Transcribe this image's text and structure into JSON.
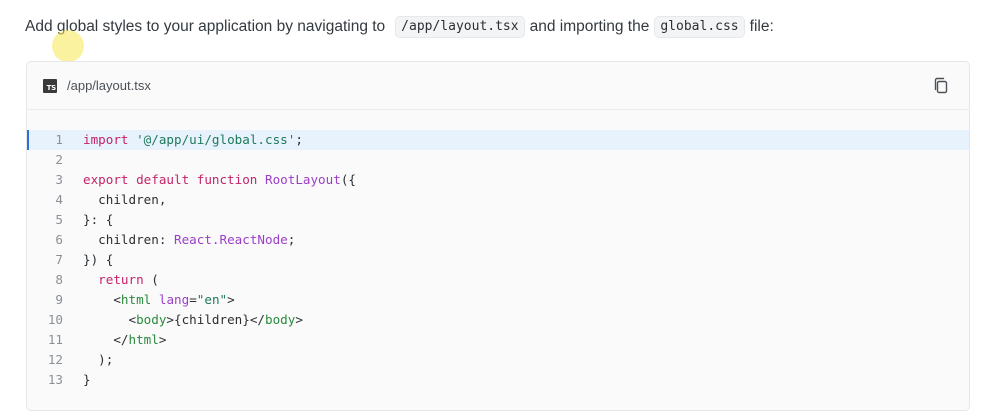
{
  "intro": {
    "text_before": "Add global styles to your application by navigating to",
    "path_code": "/app/layout.tsx",
    "text_middle": "and importing the",
    "file_code": "global.css",
    "text_after": "file:"
  },
  "code_block": {
    "file_icon": "TS",
    "file_path": "/app/layout.tsx",
    "copy_icon": "copy-icon",
    "highlighted_line": 1,
    "lines": [
      {
        "n": "1",
        "tokens": [
          [
            "kw",
            "import"
          ],
          [
            "pl",
            " "
          ],
          [
            "str",
            "'@/app/ui/global.css'"
          ],
          [
            "pl",
            ";"
          ]
        ]
      },
      {
        "n": "2",
        "tokens": []
      },
      {
        "n": "3",
        "tokens": [
          [
            "kw",
            "export default function"
          ],
          [
            "pl",
            " "
          ],
          [
            "fn",
            "RootLayout"
          ],
          [
            "pl",
            "({"
          ]
        ]
      },
      {
        "n": "4",
        "tokens": [
          [
            "pl",
            "  children,"
          ]
        ]
      },
      {
        "n": "5",
        "tokens": [
          [
            "pl",
            "}: {"
          ]
        ]
      },
      {
        "n": "6",
        "tokens": [
          [
            "pl",
            "  children: "
          ],
          [
            "ty",
            "React.ReactNode"
          ],
          [
            "pl",
            ";"
          ]
        ]
      },
      {
        "n": "7",
        "tokens": [
          [
            "pl",
            "}) {"
          ]
        ]
      },
      {
        "n": "8",
        "tokens": [
          [
            "pl",
            "  "
          ],
          [
            "kw",
            "return"
          ],
          [
            "pl",
            " ("
          ]
        ]
      },
      {
        "n": "9",
        "tokens": [
          [
            "pl",
            "    <"
          ],
          [
            "tag",
            "html"
          ],
          [
            "pl",
            " "
          ],
          [
            "attr",
            "lang"
          ],
          [
            "pl",
            "="
          ],
          [
            "str",
            "\"en\""
          ],
          [
            "pl",
            ">"
          ]
        ]
      },
      {
        "n": "10",
        "tokens": [
          [
            "pl",
            "      <"
          ],
          [
            "tag",
            "body"
          ],
          [
            "pl",
            ">{children}</"
          ],
          [
            "tag",
            "body"
          ],
          [
            "pl",
            ">"
          ]
        ]
      },
      {
        "n": "11",
        "tokens": [
          [
            "pl",
            "    </"
          ],
          [
            "tag",
            "html"
          ],
          [
            "pl",
            ">"
          ]
        ]
      },
      {
        "n": "12",
        "tokens": [
          [
            "pl",
            "  );"
          ]
        ]
      },
      {
        "n": "13",
        "tokens": [
          [
            "pl",
            "}"
          ]
        ]
      }
    ]
  }
}
